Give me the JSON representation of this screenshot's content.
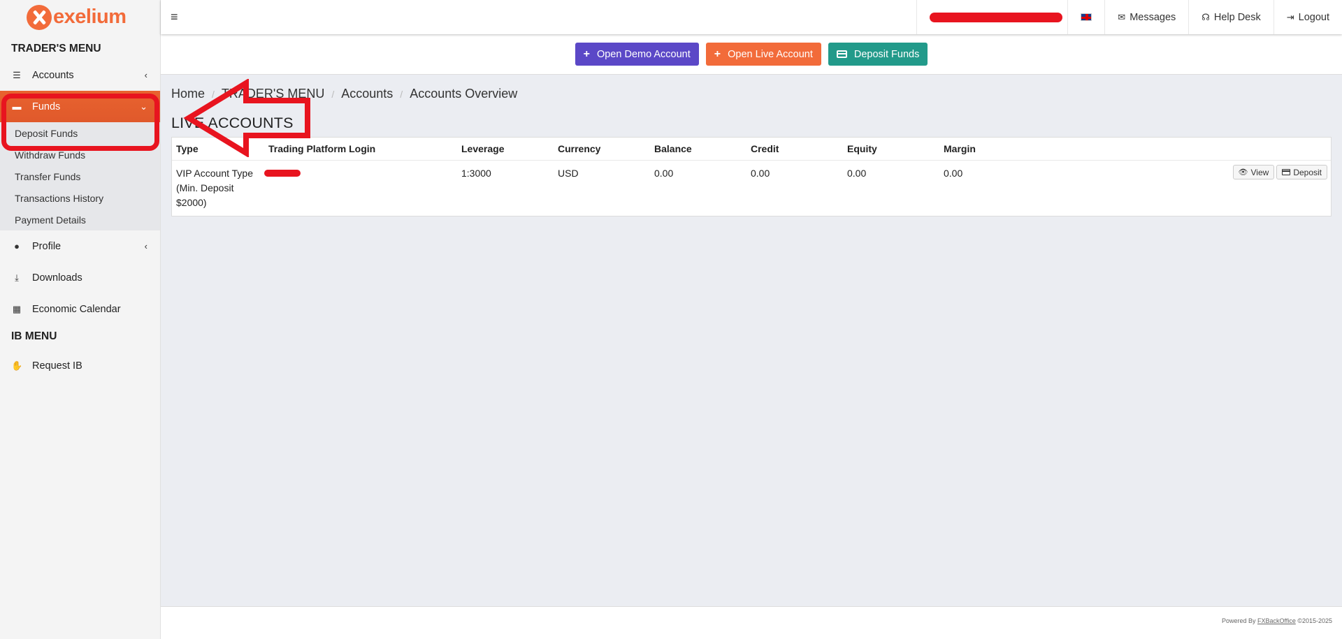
{
  "brand": {
    "name": "exelium",
    "color": "#f26b3a"
  },
  "sidebar": {
    "traders_heading": "TRADER'S MENU",
    "items": [
      {
        "label": "Accounts",
        "icon": "list-icon",
        "chevron": "‹"
      },
      {
        "label": "Funds",
        "icon": "wallet-icon",
        "chevron": "⌄"
      },
      {
        "label": "Profile",
        "icon": "user-icon",
        "chevron": "‹"
      },
      {
        "label": "Downloads",
        "icon": "download-icon"
      },
      {
        "label": "Economic Calendar",
        "icon": "calendar-icon"
      }
    ],
    "funds_submenu": [
      "Deposit Funds",
      "Withdraw Funds",
      "Transfer Funds",
      "Transactions History",
      "Payment Details"
    ],
    "ib_heading": "IB MENU",
    "ib_items": [
      {
        "label": "Request IB",
        "icon": "handshake-icon"
      }
    ]
  },
  "topbar": {
    "messages": "Messages",
    "helpdesk": "Help Desk",
    "logout": "Logout"
  },
  "actions": {
    "demo": "Open Demo Account",
    "live": "Open Live Account",
    "deposit": "Deposit Funds",
    "colors": {
      "demo": "#5b48c7",
      "live": "#f26b3a",
      "deposit": "#229a8a"
    }
  },
  "breadcrumb": [
    "Home",
    "TRADER'S MENU",
    "Accounts",
    "Accounts Overview"
  ],
  "page_title": "LIVE ACCOUNTS",
  "table": {
    "headers": [
      "Type",
      "Trading Platform Login",
      "Leverage",
      "Currency",
      "Balance",
      "Credit",
      "Equity",
      "Margin"
    ],
    "row": {
      "type_lines": [
        "VIP Account Type",
        "(Min. Deposit",
        "$2000)"
      ],
      "leverage": "1:3000",
      "currency": "USD",
      "balance": "0.00",
      "credit": "0.00",
      "equity": "0.00",
      "margin": "0.00",
      "view_label": "View",
      "deposit_label": "Deposit"
    }
  },
  "footer": {
    "prefix": "Powered By ",
    "link": "FXBackOffice",
    "suffix": " ©2015-2025"
  }
}
